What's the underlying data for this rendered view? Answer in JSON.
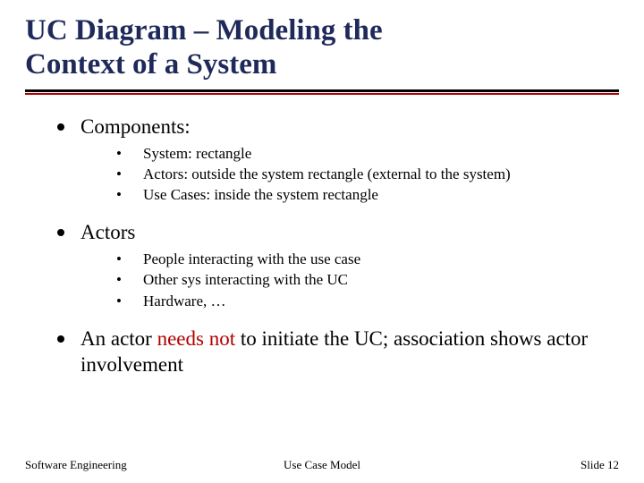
{
  "title_line1": "UC Diagram – Modeling the",
  "title_line2": "Context of a System",
  "sections": [
    {
      "heading": "Components:",
      "items": [
        "System: rectangle",
        "Actors: outside the system rectangle (external to the system)",
        "Use Cases: inside the system rectangle"
      ]
    },
    {
      "heading": "Actors",
      "items": [
        "People interacting with the use case",
        "Other sys interacting with the UC",
        "Hardware, …"
      ]
    }
  ],
  "final_bullet": {
    "pre": "An actor ",
    "highlight": "needs not",
    "post": " to initiate the UC; association shows actor involvement"
  },
  "footer": {
    "left": "Software Engineering",
    "center": "Use Case Model",
    "right": "Slide  12"
  }
}
